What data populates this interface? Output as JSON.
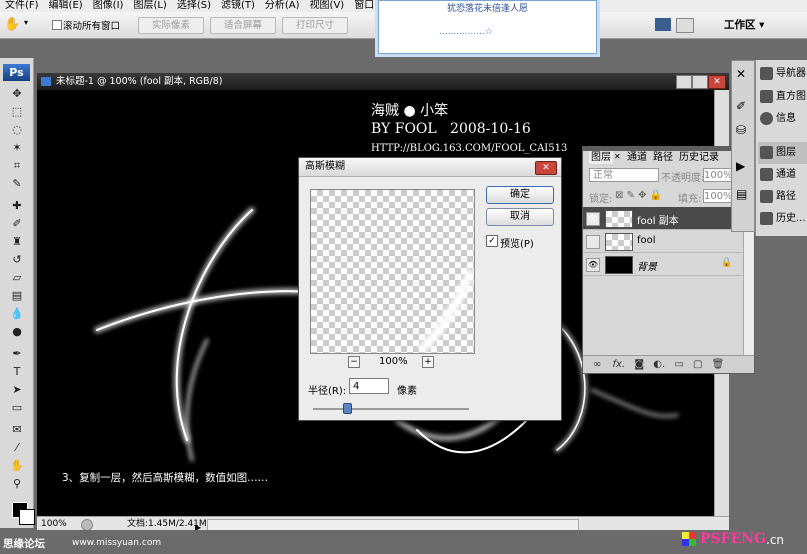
{
  "menu": [
    "文件(F)",
    "编辑(E)",
    "图像(I)",
    "图层(L)",
    "选择(S)",
    "滤镜(T)",
    "分析(A)",
    "视图(V)",
    "窗口(W)",
    "帮"
  ],
  "options": {
    "scroll_all": "滚动所有窗口",
    "actual_pixels": "实际像素",
    "fit_screen": "适合屏幕",
    "print_size": "打印尺寸",
    "workspace": "工作区 ▾"
  },
  "popup": {
    "text": "犹恐落花未倍逢人愿",
    "dots": "................☆"
  },
  "document": {
    "title": "未标题-1 @ 100% (fool 副本, RGB/8)",
    "zoom": "100%",
    "doc_size": "文档:1.45M/2.41M"
  },
  "canvas_text": {
    "line1": "海贼 ● 小笨",
    "line2": "BY FOOL   2008-10-16",
    "line3": "HTTP://BLOG.163.COM/FOOL_CAI513",
    "caption": "3、复制一层，然后高斯模糊，数值如图……"
  },
  "dialog": {
    "title": "高斯模糊",
    "ok": "确定",
    "cancel": "取消",
    "preview_label": "预览(P)",
    "preview_checked": true,
    "zoom": "100%",
    "radius_label": "半径(R):",
    "radius_value": "4",
    "radius_unit": "像素",
    "minus": "−",
    "plus": "+"
  },
  "layers_panel": {
    "tabs": [
      "图层",
      "通道",
      "路径",
      "历史记录"
    ],
    "blend_mode": "正常",
    "opacity_label": "不透明度:",
    "opacity_value": "100%",
    "lock_label": "锁定:",
    "fill_label": "填充:",
    "fill_value": "100%",
    "layers": [
      {
        "name": "fool 副本",
        "visible": true,
        "selected": true
      },
      {
        "name": "fool",
        "visible": false,
        "selected": false
      },
      {
        "name": "背景",
        "visible": true,
        "selected": false
      }
    ]
  },
  "dock": {
    "navigator": "导航器",
    "histogram": "直方图",
    "info": "信息",
    "layers": "图层",
    "channels": "通道",
    "paths": "路径",
    "history": "历史..."
  },
  "footer": {
    "left_logo": "思缘论坛",
    "left_url": "www.missyuan.com",
    "right_logo": "PSFENG",
    "right_tld": ".cn"
  },
  "colors": {
    "canvas_bg": "#000000",
    "selected_layer": "#4a4a4a"
  }
}
